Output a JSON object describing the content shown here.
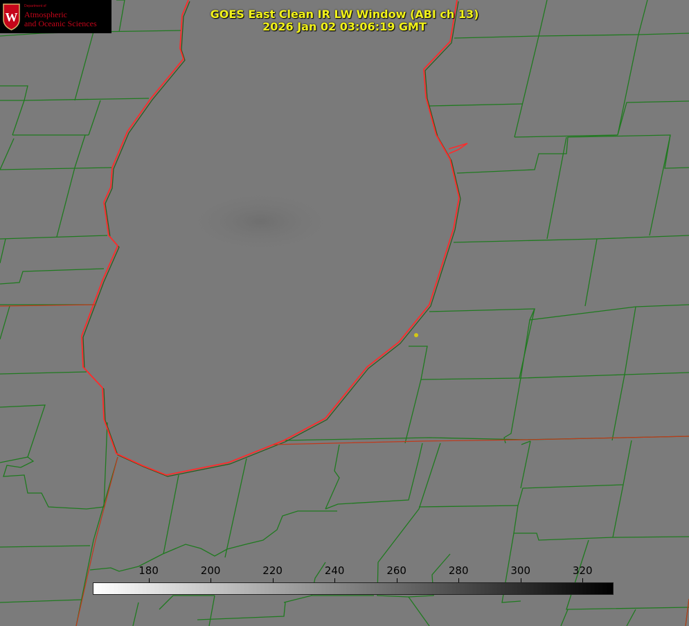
{
  "title": {
    "line1": "GOES East Clean IR LW Window (ABI ch 13)",
    "line2": "2026 Jan 02 03:06:19 GMT"
  },
  "logo": {
    "dept": "Department of",
    "line1": "Atmospheric",
    "line2": "and Oceanic Sciences",
    "letter": "W"
  },
  "colorbar": {
    "ticks": [
      "180",
      "200",
      "220",
      "240",
      "260",
      "280",
      "300",
      "320"
    ],
    "min": 162,
    "max": 330,
    "gradient_start": "#ffffff",
    "gradient_end": "#000000"
  },
  "colors": {
    "background": "#7b7b7b",
    "county_lines": "#1f7a1f",
    "coastline": "#ff2a2a",
    "title_text": "#f2f21a",
    "marker": "#d4c814"
  }
}
